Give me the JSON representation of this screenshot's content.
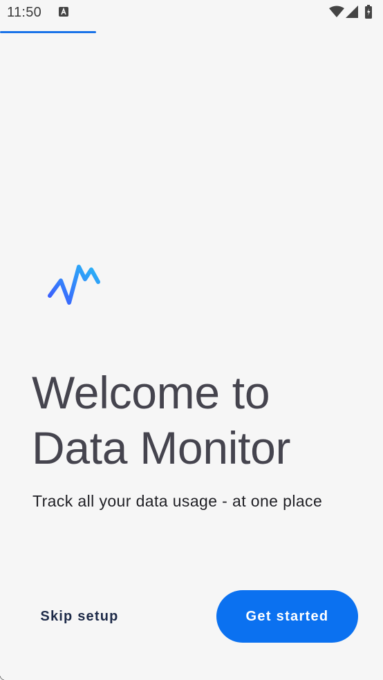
{
  "status_bar": {
    "time": "11:50",
    "icons": [
      "a-notification-icon",
      "wifi-icon",
      "signal-icon",
      "battery-icon"
    ]
  },
  "progress": {
    "step_fraction": 0.25,
    "color": "#1a73e8"
  },
  "logo": {
    "icon": "pulse-chart-icon",
    "gradient_start": "#3d5afe",
    "gradient_end": "#29b6f6"
  },
  "welcome": {
    "title_line1": "Welcome to",
    "title_line2": "Data Monitor",
    "subtitle": "Track all your data usage - at one place"
  },
  "actions": {
    "skip_label": "Skip setup",
    "get_started_label": "Get started",
    "primary_color": "#0b71f0"
  }
}
